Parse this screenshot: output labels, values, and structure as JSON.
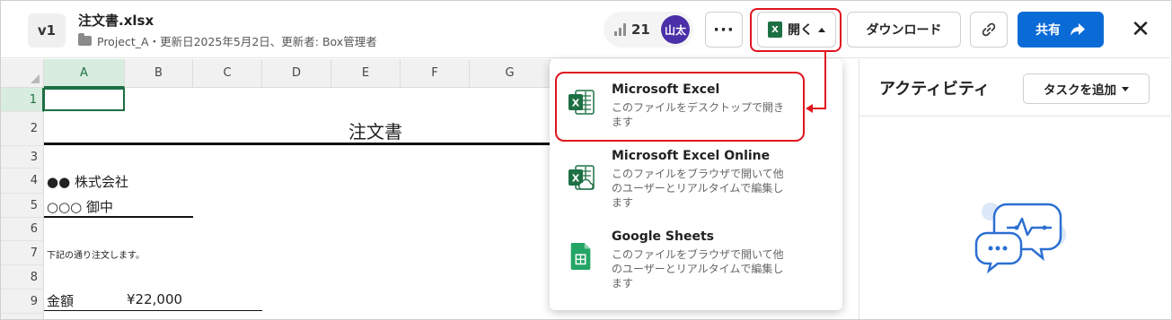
{
  "header": {
    "version": "v1",
    "filename": "注文書.xlsx",
    "meta": "Project_A・更新日2025年5月2日、更新者: Box管理者",
    "views": "21",
    "avatar": "山太",
    "more_label": "···",
    "open_label": "開く",
    "excel_mini": "X",
    "download_label": "ダウンロード",
    "share_label": "共有",
    "close_label": "✕"
  },
  "sheet": {
    "columns": [
      "A",
      "B",
      "C",
      "D",
      "E",
      "F",
      "G"
    ],
    "rows": [
      "1",
      "2",
      "3",
      "4",
      "5",
      "6",
      "7",
      "8",
      "9"
    ],
    "cells": {
      "title": "注文書",
      "company": "●● 株式会社",
      "recipient": "○○○ 御中",
      "note": "下記の通り注文します。",
      "amount_label": "金額",
      "amount_value": "¥22,000"
    }
  },
  "dropdown": {
    "items": [
      {
        "title": "Microsoft Excel",
        "desc": "このファイルをデスクトップで開きます"
      },
      {
        "title": "Microsoft Excel Online",
        "desc": "このファイルをブラウザで開いて他のユーザーとリアルタイムで編集します"
      },
      {
        "title": "Google Sheets",
        "desc": "このファイルをブラウザで開いて他のユーザーとリアルタイムで編集します"
      }
    ]
  },
  "activity": {
    "title": "アクティビティ",
    "task_button": "タスクを追加"
  },
  "colors": {
    "excel_green": "#1d7044",
    "share_blue": "#0b6bd6",
    "highlight_red": "#e0141e",
    "avatar_purple": "#4b2fa8",
    "sheets_green": "#23a566"
  }
}
